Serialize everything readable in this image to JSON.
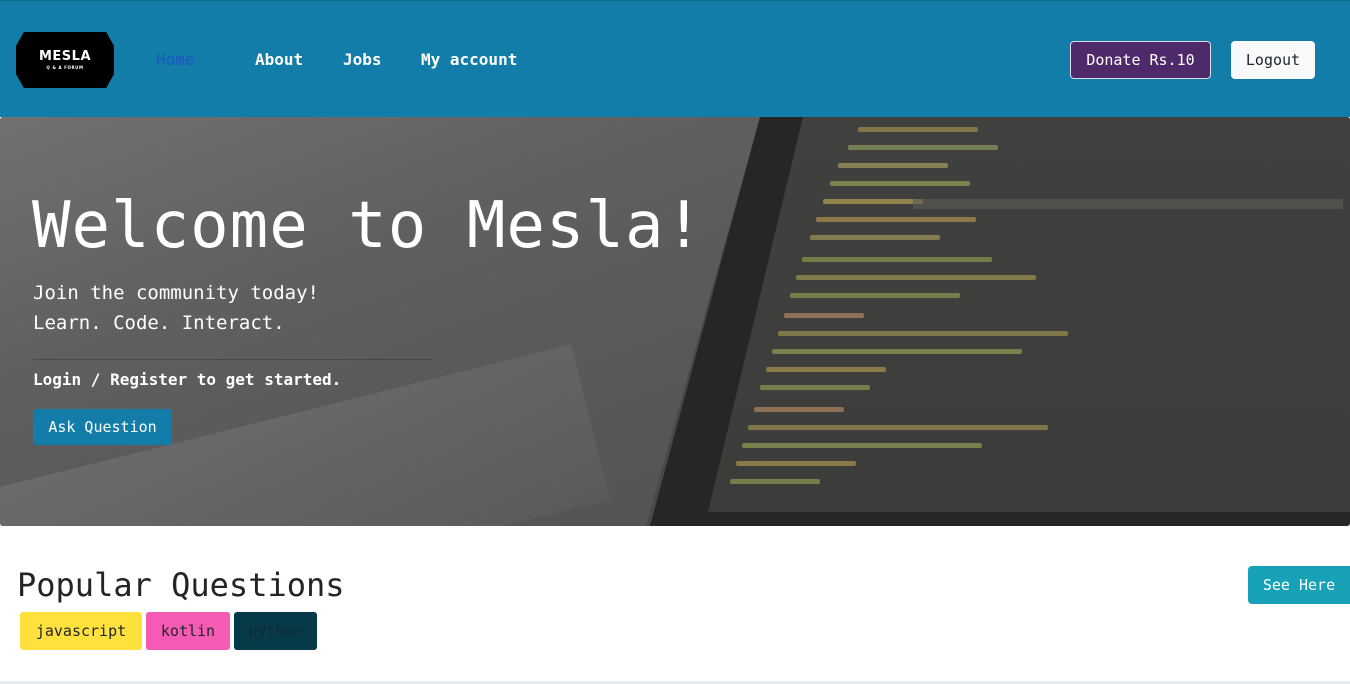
{
  "navbar": {
    "logo": {
      "title": "MESLA",
      "subtitle": "Q & A FORUM"
    },
    "links": [
      {
        "label": "Home",
        "active": true
      },
      {
        "label": "About"
      },
      {
        "label": "Jobs"
      },
      {
        "label": "My account"
      }
    ],
    "donate_label": "Donate Rs.10",
    "logout_label": "Logout",
    "colors": {
      "background": "#137daa",
      "donate": "#4e2a6b"
    }
  },
  "hero": {
    "title": "Welcome to Mesla!",
    "lead_line1": "Join the community today!",
    "lead_line2": "Learn. Code. Interact.",
    "cta_text": "Login / Register to get started.",
    "ask_button_label": "Ask Question",
    "background_image": "laptop-with-code-photo"
  },
  "popular": {
    "title": "Popular Questions",
    "see_button_label": "See Here",
    "tags": [
      {
        "label": "javascript",
        "color": "#ffe13d"
      },
      {
        "label": "kotlin",
        "color": "#f55bb4"
      },
      {
        "label": "python",
        "color": "#063a49"
      }
    ]
  }
}
